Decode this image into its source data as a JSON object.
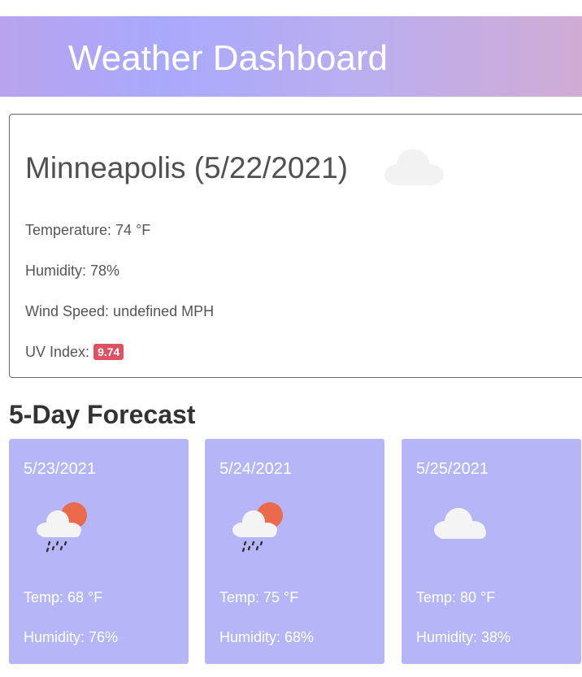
{
  "header": {
    "title": "Weather Dashboard"
  },
  "current": {
    "city_date": "Minneapolis (5/22/2021)",
    "icon": "cloud-icon",
    "temperature": "Temperature: 74 °F",
    "humidity": "Humidity: 78%",
    "wind": "Wind Speed: undefined MPH",
    "uv_label": "UV Index:",
    "uv_value": "9.74"
  },
  "forecast": {
    "heading": "5-Day Forecast",
    "days": [
      {
        "date": "5/23/2021",
        "icon": "rain-sun-icon",
        "temp": "Temp: 68 °F",
        "humidity": "Humidity: 76%"
      },
      {
        "date": "5/24/2021",
        "icon": "rain-sun-icon",
        "temp": "Temp: 75 °F",
        "humidity": "Humidity: 68%"
      },
      {
        "date": "5/25/2021",
        "icon": "cloud-icon",
        "temp": "Temp: 80 °F",
        "humidity": "Humidity: 38%"
      }
    ]
  },
  "colors": {
    "header_gradient": [
      "#b9a3ee",
      "#a9a9fc",
      "#d1acd4"
    ],
    "card_bg": "#b6b5f7",
    "uv_badge": "#dc5262"
  }
}
